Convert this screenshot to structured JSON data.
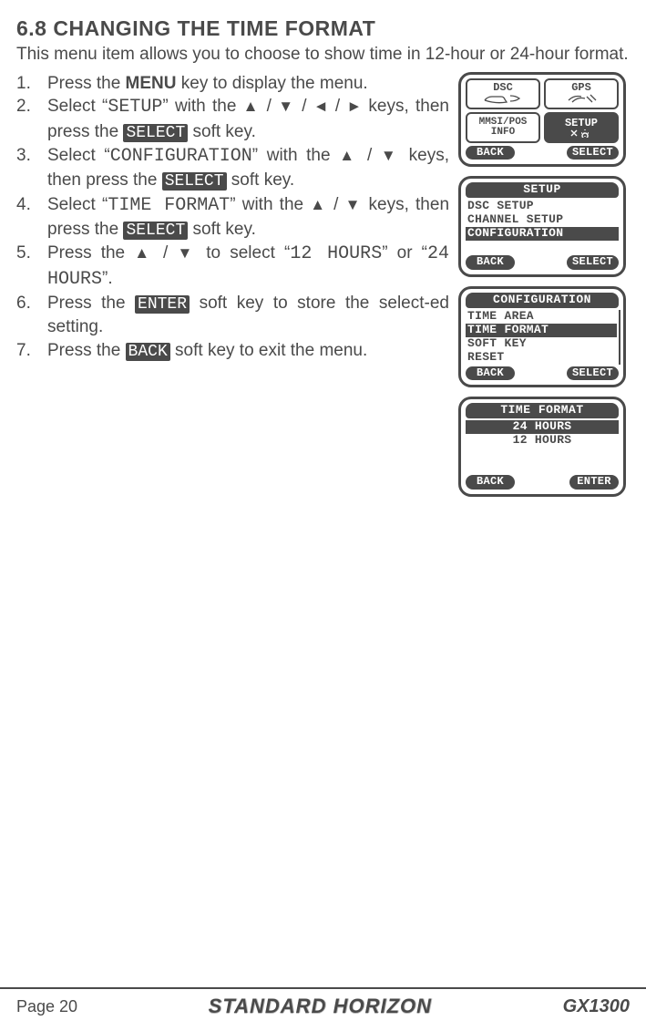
{
  "heading": "6.8  CHANGING THE TIME FORMAT",
  "intro": "This menu item allows you to choose to show time in 12-hour or 24-hour format.",
  "steps": [
    {
      "num": "1.",
      "parts": [
        "Press the ",
        {
          "k": "menu",
          "v": "MENU"
        },
        " key to display the menu."
      ]
    },
    {
      "num": "2.",
      "parts": [
        "Select “",
        {
          "k": "mono",
          "v": "SETUP"
        },
        "” with the ",
        {
          "k": "arr",
          "v": "▲"
        },
        " / ",
        {
          "k": "arr",
          "v": "▼"
        },
        " / ",
        {
          "k": "arr",
          "v": "◄"
        },
        " / ",
        {
          "k": "arr",
          "v": "►"
        },
        " keys, then press the ",
        {
          "k": "soft",
          "v": "SELECT"
        },
        " soft key."
      ]
    },
    {
      "num": "3.",
      "parts": [
        "Select “",
        {
          "k": "mono",
          "v": "CONFIGURATION"
        },
        "” with the ",
        {
          "k": "arr",
          "v": "▲"
        },
        " / ",
        {
          "k": "arr",
          "v": "▼"
        },
        " keys, then press the ",
        {
          "k": "soft",
          "v": "SELECT"
        },
        " soft key."
      ]
    },
    {
      "num": "4.",
      "parts": [
        "Select “",
        {
          "k": "mono",
          "v": "TIME FORMAT"
        },
        "” with the ",
        {
          "k": "arr",
          "v": "▲"
        },
        " / ",
        {
          "k": "arr",
          "v": "▼"
        },
        " keys, then press the ",
        {
          "k": "soft",
          "v": "SELECT"
        },
        " soft key."
      ]
    },
    {
      "num": "5.",
      "parts": [
        "Press the ",
        {
          "k": "arr",
          "v": "▲"
        },
        " / ",
        {
          "k": "arr",
          "v": "▼"
        },
        " to select “",
        {
          "k": "mono",
          "v": "12 HOURS"
        },
        "” or “",
        {
          "k": "mono",
          "v": "24 HOURS"
        },
        "”."
      ]
    },
    {
      "num": "6.",
      "parts": [
        "Press the ",
        {
          "k": "soft",
          "v": "ENTER"
        },
        " soft key to store the select-ed setting."
      ]
    },
    {
      "num": "7.",
      "parts": [
        "Press the ",
        {
          "k": "soft",
          "v": "BACK"
        },
        " soft key to exit the menu."
      ]
    }
  ],
  "screens": {
    "s1": {
      "tiles": {
        "dsc": "DSC",
        "gps": "GPS",
        "mmsi_l1": "MMSI/POS",
        "mmsi_l2": "INFO",
        "setup": "SETUP"
      },
      "back": "BACK",
      "select": "SELECT"
    },
    "s2": {
      "title": "SETUP",
      "items": [
        "DSC SETUP",
        "CHANNEL SETUP",
        "CONFIGURATION"
      ],
      "selectedIndex": 2,
      "back": "BACK",
      "select": "SELECT"
    },
    "s3": {
      "title": "CONFIGURATION",
      "items": [
        "TIME AREA",
        "TIME FORMAT",
        "SOFT KEY",
        "RESET"
      ],
      "selectedIndex": 1,
      "back": "BACK",
      "select": "SELECT"
    },
    "s4": {
      "title": "TIME FORMAT",
      "items": [
        "24 HOURS",
        "12 HOURS"
      ],
      "selectedIndex": 0,
      "back": "BACK",
      "enter": "ENTER"
    }
  },
  "footer": {
    "page": "Page 20",
    "brand": "STANDARD HORIZON",
    "model": "GX1300"
  }
}
